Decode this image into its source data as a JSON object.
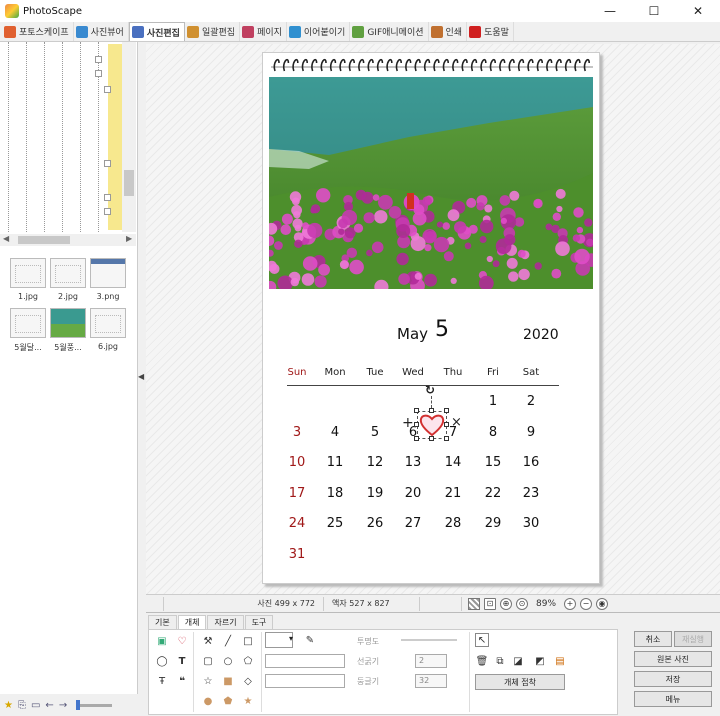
{
  "window": {
    "title": "PhotoScape",
    "minimize": "—",
    "maximize": "☐",
    "close": "✕"
  },
  "tabs": [
    {
      "label": "포토스케이프",
      "color": "#e06030",
      "active": false
    },
    {
      "label": "사진뷰어",
      "color": "#3a8ad0",
      "active": false
    },
    {
      "label": "사진편집",
      "color": "#4a70c0",
      "active": true
    },
    {
      "label": "일괄편집",
      "color": "#d09030",
      "active": false
    },
    {
      "label": "페이지",
      "color": "#c04060",
      "active": false
    },
    {
      "label": "이어붙이기",
      "color": "#3090d0",
      "active": false
    },
    {
      "label": "GIF애니메이션",
      "color": "#60a040",
      "active": false
    },
    {
      "label": "인쇄",
      "color": "#c07030",
      "active": false
    },
    {
      "label": "도움말",
      "color": "#d02020",
      "active": false
    }
  ],
  "thumbnails": [
    {
      "label": "1.jpg"
    },
    {
      "label": "2.jpg"
    },
    {
      "label": "3.png"
    },
    {
      "label": "5월달..."
    },
    {
      "label": "5월풍..."
    },
    {
      "label": "6.jpg"
    }
  ],
  "calendar": {
    "month": "May",
    "day": "5",
    "year": "2020",
    "weekdays": [
      "Sun",
      "Mon",
      "Tue",
      "Wed",
      "Thu",
      "Fri",
      "Sat"
    ],
    "weeks": [
      [
        "",
        "",
        "",
        "",
        "",
        "1",
        "2"
      ],
      [
        "3",
        "4",
        "5",
        "6",
        "7",
        "8",
        "9"
      ],
      [
        "10",
        "11",
        "12",
        "13",
        "14",
        "15",
        "16"
      ],
      [
        "17",
        "18",
        "19",
        "20",
        "21",
        "22",
        "23"
      ],
      [
        "24",
        "25",
        "26",
        "27",
        "28",
        "29",
        "30"
      ],
      [
        "31",
        "",
        "",
        "",
        "",
        "",
        ""
      ]
    ],
    "sunday_color": "#a01818"
  },
  "status": {
    "photo_size": "사진 499 x 772",
    "frame_size": "액자 527 x 827",
    "zoom": "89%"
  },
  "bottom": {
    "subtabs": [
      "기본",
      "개체",
      "자르기",
      "도구"
    ],
    "active_subtab": "개체",
    "opacity_label": "투명도",
    "line_width_label": "선굵기",
    "rounding_label": "둥글기",
    "line_width_value": "2",
    "rounding_value": "32",
    "object_attach": "개체 접착",
    "undo": "취소",
    "redo": "재실행",
    "original": "원본 사진",
    "save": "저장",
    "menu": "메뉴"
  }
}
